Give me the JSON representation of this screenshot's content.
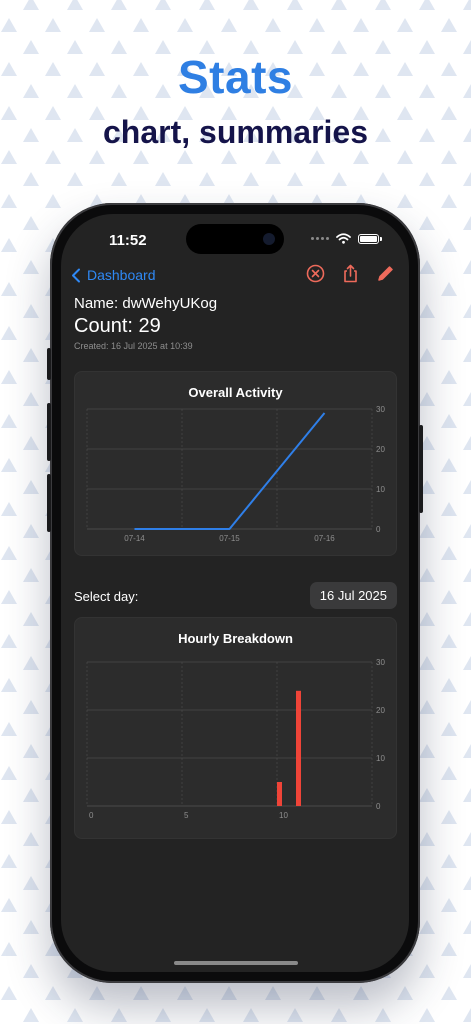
{
  "promo": {
    "title": "Stats",
    "subtitle": "chart, summaries"
  },
  "status_bar": {
    "time": "11:52"
  },
  "nav": {
    "back_label": "Dashboard",
    "actions": [
      "close-circle-icon",
      "share-icon",
      "pencil-icon"
    ],
    "accent_color": "#2f89f5",
    "action_color": "#ee6a5b"
  },
  "info": {
    "name": "Name: dwWehyUKog",
    "count": "Count: 29",
    "created": "Created: 16 Jul 2025 at 10:39"
  },
  "day_select": {
    "label": "Select day:",
    "value": "16 Jul 2025"
  },
  "chart_data": [
    {
      "type": "line",
      "title": "Overall Activity",
      "categories": [
        "07-14",
        "07-15",
        "07-16"
      ],
      "series": [
        {
          "values": [
            0,
            0,
            29
          ],
          "color": "#2f7fe8"
        }
      ],
      "y_ticks": [
        0,
        10,
        20,
        30
      ],
      "ylim": [
        0,
        30
      ],
      "y_axis_side": "right",
      "grid": true
    },
    {
      "type": "bar",
      "title": "Hourly Breakdown",
      "x_ticks": [
        0,
        5,
        10
      ],
      "x_range": [
        0,
        15
      ],
      "bars": [
        {
          "x": 10,
          "value": 5
        },
        {
          "x": 11,
          "value": 24
        }
      ],
      "bar_color": "#ef4438",
      "y_ticks": [
        0,
        10,
        20,
        30
      ],
      "ylim": [
        0,
        30
      ],
      "y_axis_side": "right",
      "grid": true
    }
  ]
}
